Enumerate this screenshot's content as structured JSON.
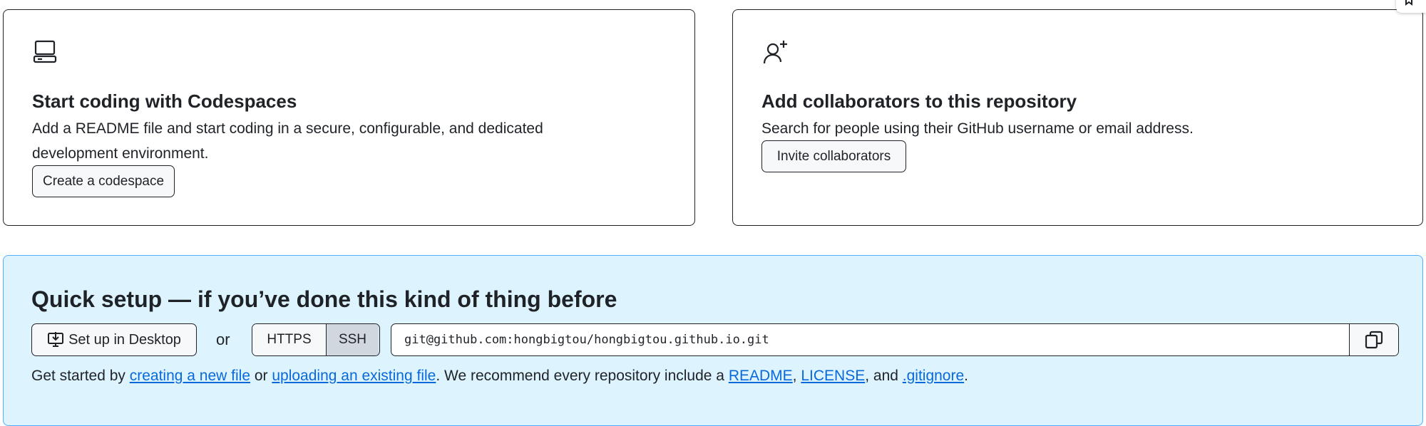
{
  "codespaces_card": {
    "icon": "device-desktop-icon",
    "title": "Start coding with Codespaces",
    "description": "Add a README file and start coding in a secure, configurable, and dedicated development environment.",
    "button_label": "Create a codespace"
  },
  "collaborators_card": {
    "icon": "person-add-icon",
    "title": "Add collaborators to this repository",
    "description": "Search for people using their GitHub username or email address.",
    "button_label": "Invite collaborators"
  },
  "quick_setup": {
    "title": "Quick setup — if you’ve done this kind of thing before",
    "desktop_button_label": "Set up in Desktop",
    "or_label": "or",
    "protocols": [
      "HTTPS",
      "SSH"
    ],
    "selected_protocol": "SSH",
    "clone_url": "git@github.com:hongbigtou/hongbigtou.github.io.git",
    "copy_icon": "copy-icon",
    "help": {
      "prefix": "Get started by ",
      "link_new_file": "creating a new file",
      "mid1": " or ",
      "link_upload": "uploading an existing file",
      "mid2": ". We recommend every repository include a ",
      "link_readme": "README",
      "sep1": ", ",
      "link_license": "LICENSE",
      "sep2": ", and ",
      "link_gitignore": ".gitignore",
      "suffix": "."
    }
  },
  "colors": {
    "accent": "#0969da",
    "quick_setup_bg": "#ddf4ff",
    "quick_setup_border": "#54aeff"
  }
}
